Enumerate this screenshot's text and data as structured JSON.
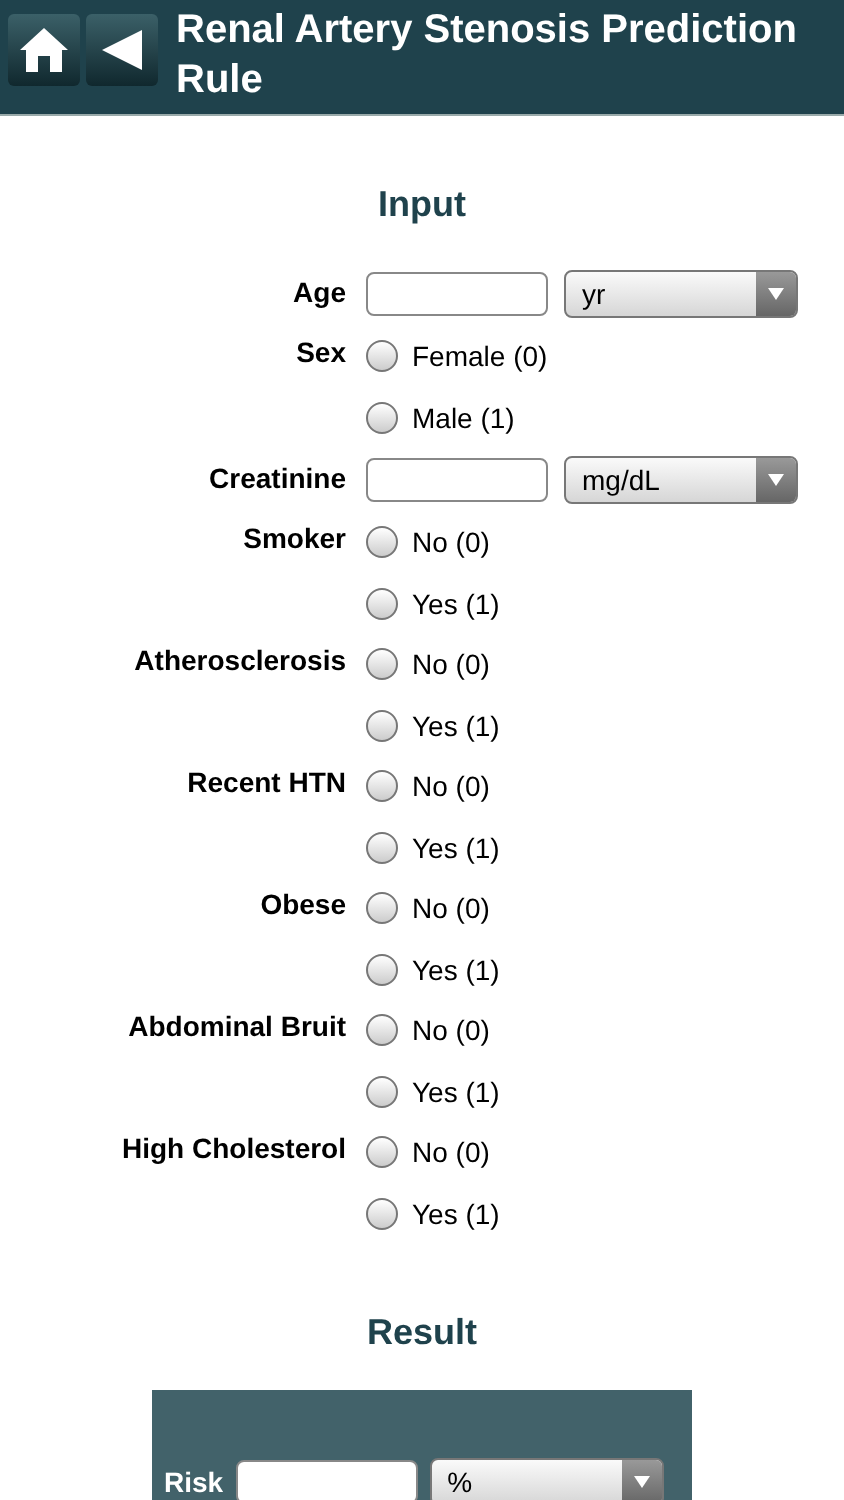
{
  "header": {
    "title": "Renal Artery Stenosis Prediction Rule"
  },
  "input_section": {
    "title": "Input",
    "fields": [
      {
        "kind": "number",
        "label": "Age",
        "unit": "yr"
      },
      {
        "kind": "radio",
        "label": "Sex",
        "options": [
          {
            "label": "Female (0)",
            "selected": false
          },
          {
            "label": "Male (1)",
            "selected": false
          }
        ]
      },
      {
        "kind": "number",
        "label": "Creatinine",
        "unit": "mg/dL"
      },
      {
        "kind": "radio",
        "label": "Smoker",
        "options": [
          {
            "label": "No (0)",
            "selected": false
          },
          {
            "label": "Yes (1)",
            "selected": false
          }
        ]
      },
      {
        "kind": "radio",
        "label": "Atherosclerosis",
        "options": [
          {
            "label": "No (0)",
            "selected": false
          },
          {
            "label": "Yes (1)",
            "selected": false
          }
        ]
      },
      {
        "kind": "radio",
        "label": "Recent HTN",
        "options": [
          {
            "label": "No (0)",
            "selected": false
          },
          {
            "label": "Yes (1)",
            "selected": false
          }
        ]
      },
      {
        "kind": "radio",
        "label": "Obese",
        "options": [
          {
            "label": "No (0)",
            "selected": false
          },
          {
            "label": "Yes (1)",
            "selected": false
          }
        ]
      },
      {
        "kind": "radio",
        "label": "Abdominal Bruit",
        "options": [
          {
            "label": "No (0)",
            "selected": false
          },
          {
            "label": "Yes (1)",
            "selected": false
          }
        ]
      },
      {
        "kind": "radio",
        "label": "High Cholesterol",
        "options": [
          {
            "label": "No (0)",
            "selected": false
          },
          {
            "label": "Yes (1)",
            "selected": false
          }
        ]
      }
    ]
  },
  "result_section": {
    "title": "Result",
    "label": "Risk",
    "unit": "%"
  }
}
